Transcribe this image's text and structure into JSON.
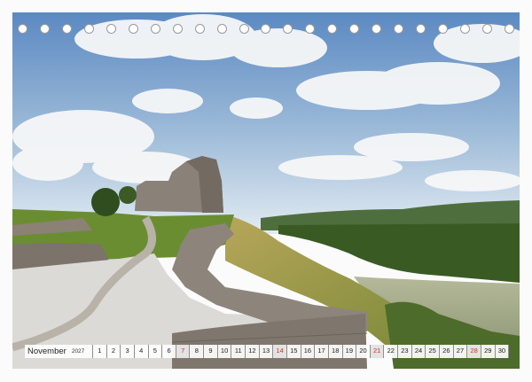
{
  "calendar": {
    "month": "November",
    "year": "2027",
    "days": [
      {
        "n": "1",
        "red": false
      },
      {
        "n": "2",
        "red": false
      },
      {
        "n": "3",
        "red": false
      },
      {
        "n": "4",
        "red": false
      },
      {
        "n": "5",
        "red": false
      },
      {
        "n": "6",
        "red": false
      },
      {
        "n": "7",
        "red": true
      },
      {
        "n": "8",
        "red": false
      },
      {
        "n": "9",
        "red": false
      },
      {
        "n": "10",
        "red": false
      },
      {
        "n": "11",
        "red": false
      },
      {
        "n": "12",
        "red": false
      },
      {
        "n": "13",
        "red": false
      },
      {
        "n": "14",
        "red": true
      },
      {
        "n": "15",
        "red": false
      },
      {
        "n": "16",
        "red": false
      },
      {
        "n": "17",
        "red": false
      },
      {
        "n": "18",
        "red": false
      },
      {
        "n": "19",
        "red": false
      },
      {
        "n": "20",
        "red": false
      },
      {
        "n": "21",
        "red": true
      },
      {
        "n": "22",
        "red": false
      },
      {
        "n": "23",
        "red": false
      },
      {
        "n": "24",
        "red": false
      },
      {
        "n": "25",
        "red": false
      },
      {
        "n": "26",
        "red": false
      },
      {
        "n": "27",
        "red": false
      },
      {
        "n": "28",
        "red": true
      },
      {
        "n": "29",
        "red": false
      },
      {
        "n": "30",
        "red": false
      }
    ]
  },
  "binding": {
    "ring_count": 23
  },
  "colors": {
    "sunday": "#c0392b",
    "sky_top": "#5f8cc4",
    "sky_bottom": "#dfe9f2",
    "grass": "#6f8f34",
    "stone": "#8a8178",
    "river": "#a7ad8a"
  }
}
